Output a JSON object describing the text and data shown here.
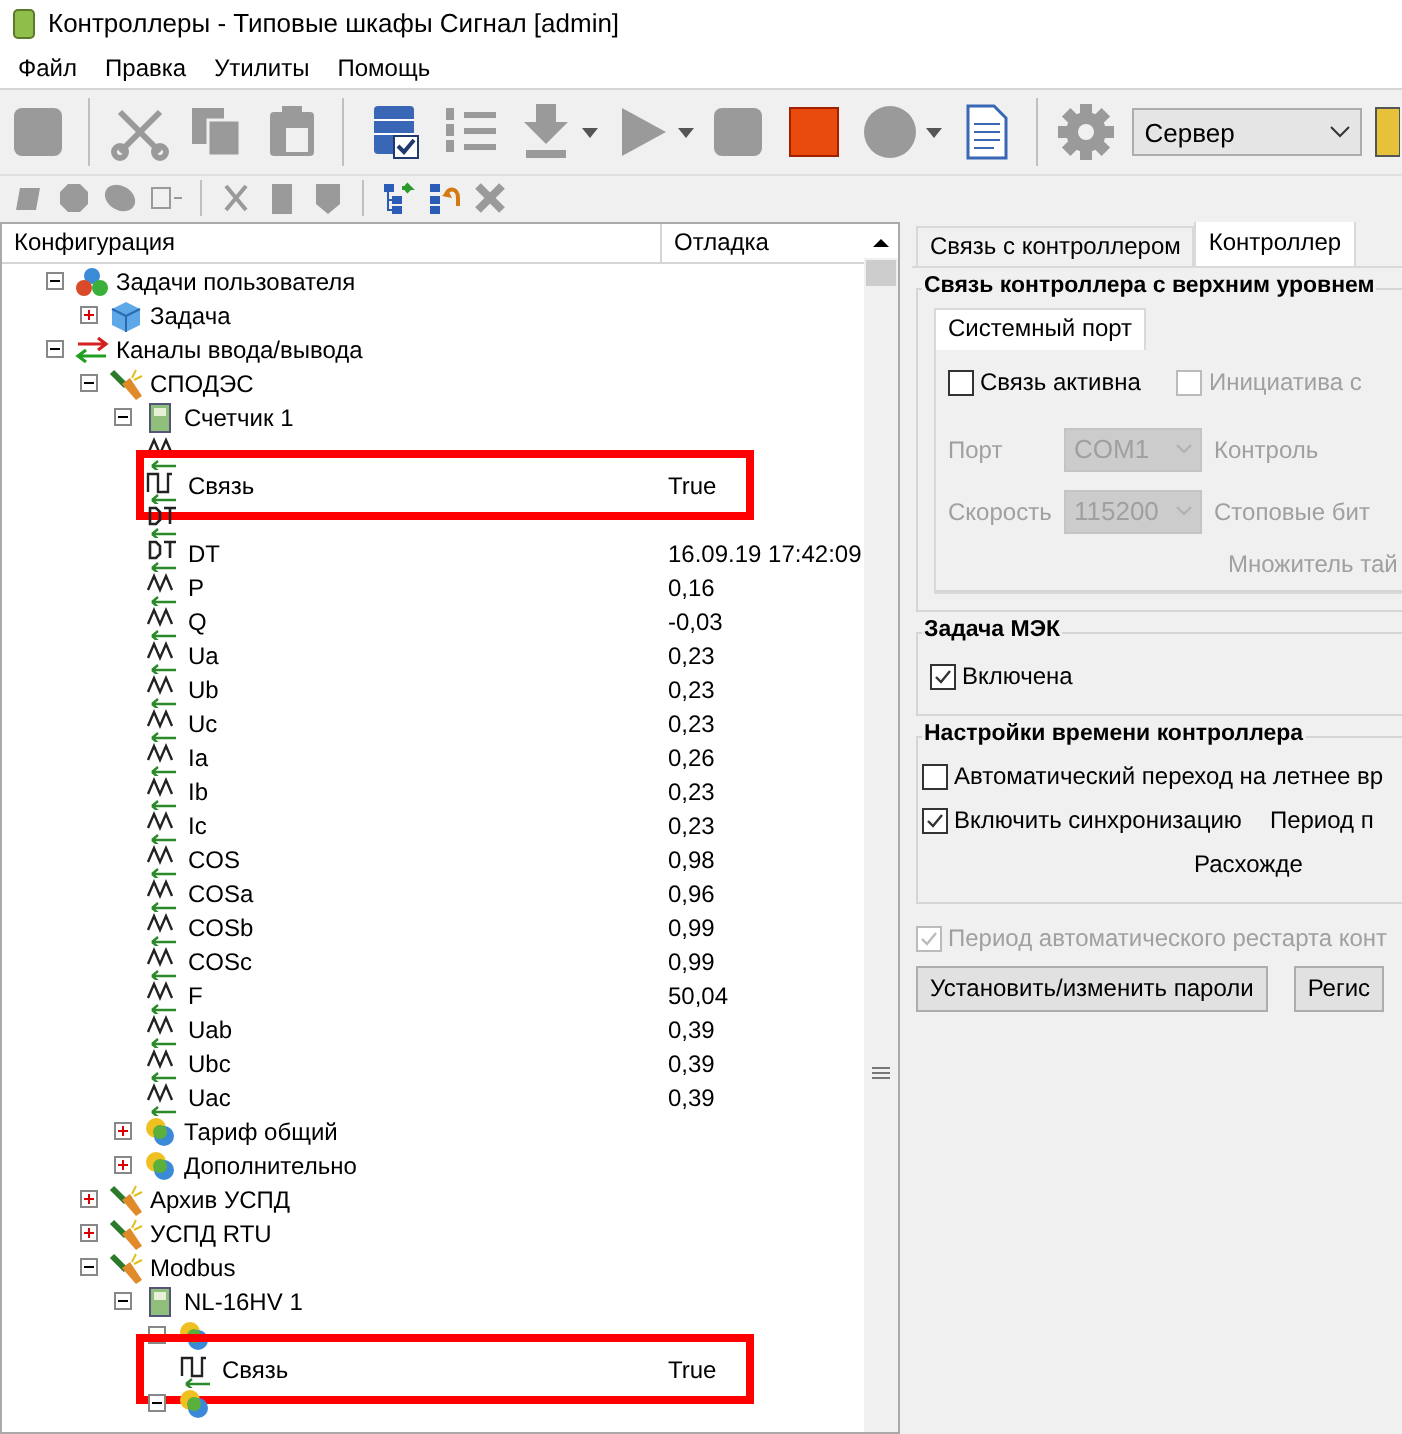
{
  "window": {
    "title": "Контроллеры - Типовые шкафы Сигнал [admin]"
  },
  "menu": [
    "Файл",
    "Правка",
    "Утилиты",
    "Помощь"
  ],
  "toolbar": [
    {
      "kind": "block",
      "disabled": true
    },
    {
      "kind": "separator"
    },
    {
      "kind": "cut",
      "disabled": true
    },
    {
      "kind": "copy",
      "disabled": true
    },
    {
      "kind": "paste",
      "disabled": true
    },
    {
      "kind": "separator"
    },
    {
      "kind": "database",
      "disabled": false
    },
    {
      "kind": "list",
      "disabled": true
    },
    {
      "kind": "download",
      "disabled": true,
      "dropdown": true
    },
    {
      "kind": "play",
      "disabled": true,
      "dropdown": true
    },
    {
      "kind": "block",
      "disabled": true
    },
    {
      "kind": "record",
      "disabled": false
    },
    {
      "kind": "circle",
      "disabled": true,
      "dropdown": true
    },
    {
      "kind": "document",
      "disabled": false
    },
    {
      "kind": "separator"
    },
    {
      "kind": "gear",
      "disabled": true
    },
    {
      "kind": "select",
      "value": "Сервер"
    },
    {
      "kind": "tool",
      "disabled": false
    }
  ],
  "toolbar_2": [
    {
      "kind": "hex",
      "disabled": true
    },
    {
      "kind": "octagon",
      "disabled": true
    },
    {
      "kind": "ellipse",
      "disabled": true
    },
    {
      "kind": "fields",
      "disabled": true
    },
    {
      "kind": "separator"
    },
    {
      "kind": "cut",
      "disabled": true
    },
    {
      "kind": "bin",
      "disabled": true
    },
    {
      "kind": "shield",
      "disabled": true
    },
    {
      "kind": "separator"
    },
    {
      "kind": "tree-add",
      "disabled": false
    },
    {
      "kind": "tree-undo",
      "disabled": false
    },
    {
      "kind": "cross",
      "disabled": true
    }
  ],
  "tree": {
    "columns": [
      "Конфигурация",
      "Отладка"
    ],
    "items": [
      {
        "label": "Задачи пользователя",
        "kind": "tasks",
        "expanded": true,
        "children": [
          {
            "label": "Задача",
            "kind": "cube",
            "expanded": false
          }
        ]
      },
      {
        "label": "Каналы ввода/вывода",
        "kind": "channels",
        "expanded": true,
        "children": [
          {
            "label": "СПОДЭС",
            "kind": "plug",
            "expanded": true,
            "children": [
              {
                "label": "Счетчик 1",
                "kind": "meter",
                "expanded": true,
                "children": [
                  {
                    "kind": "analog"
                  },
                  {
                    "label": "Связь",
                    "kind": "discrete",
                    "value": "True",
                    "highlighted": true
                  },
                  {
                    "kind": "datetime"
                  },
                  {
                    "label": "DT",
                    "kind": "datetime",
                    "value": "16.09.19 17:42:09"
                  },
                  {
                    "label": "P",
                    "kind": "analog",
                    "value": "0,16"
                  },
                  {
                    "label": "Q",
                    "kind": "analog",
                    "value": "-0,03"
                  },
                  {
                    "label": "Ua",
                    "kind": "analog",
                    "value": "0,23"
                  },
                  {
                    "label": "Ub",
                    "kind": "analog",
                    "value": "0,23"
                  },
                  {
                    "label": "Uc",
                    "kind": "analog",
                    "value": "0,23"
                  },
                  {
                    "label": "Ia",
                    "kind": "analog",
                    "value": "0,26"
                  },
                  {
                    "label": "Ib",
                    "kind": "analog",
                    "value": "0,23"
                  },
                  {
                    "label": "Ic",
                    "kind": "analog",
                    "value": "0,23"
                  },
                  {
                    "label": "COS",
                    "kind": "analog",
                    "value": "0,98"
                  },
                  {
                    "label": "COSa",
                    "kind": "analog",
                    "value": "0,96"
                  },
                  {
                    "label": "COSb",
                    "kind": "analog",
                    "value": "0,99"
                  },
                  {
                    "label": "COSc",
                    "kind": "analog",
                    "value": "0,99"
                  },
                  {
                    "label": "F",
                    "kind": "analog",
                    "value": "50,04"
                  },
                  {
                    "label": "Uab",
                    "kind": "analog",
                    "value": "0,39"
                  },
                  {
                    "label": "Ubc",
                    "kind": "analog",
                    "value": "0,39"
                  },
                  {
                    "label": "Uac",
                    "kind": "analog",
                    "value": "0,39"
                  }
                ]
              },
              {
                "label": "Тариф общий",
                "kind": "group",
                "expanded": false
              },
              {
                "label": "Дополнительно",
                "kind": "group",
                "expanded": false
              }
            ]
          },
          {
            "label": "Архив УСПД",
            "kind": "plug",
            "expanded": false
          },
          {
            "label": "УСПД RTU",
            "kind": "plug",
            "expanded": false
          },
          {
            "label": "Modbus",
            "kind": "plug",
            "expanded": true,
            "children": [
              {
                "label": "NL-16HV 1",
                "kind": "meter",
                "expanded": true,
                "children": [
                  {
                    "kind": "group",
                    "expanded": true,
                    "children": [
                      {
                        "label": "Связь",
                        "kind": "discrete",
                        "value": "True",
                        "highlighted": true
                      }
                    ]
                  },
                  {
                    "kind": "group",
                    "expanded": true
                  }
                ]
              }
            ]
          }
        ]
      }
    ]
  },
  "tabs": [
    {
      "label": "Связь с контроллером",
      "selected": false
    },
    {
      "label": "Контроллер",
      "selected": true
    }
  ],
  "groups": [
    {
      "kind": "uplink",
      "title": "Связь контроллера с верхним уровнем",
      "tabs": [
        {
          "label": "Системный порт",
          "selected": true
        }
      ],
      "checks": [
        {
          "label": "Связь активна",
          "checked": false,
          "disabled": false
        },
        {
          "label": "Инициатива с",
          "checked": false,
          "disabled": true
        }
      ],
      "port": {
        "label": "Порт",
        "value": "COM1",
        "side_label": "Контроль"
      },
      "speed": {
        "label": "Скорость",
        "value": "115200",
        "side_label": "Стоповые бит"
      },
      "multiplier_label": "Множитель тай"
    },
    {
      "kind": "checks",
      "title": "Задача МЭК",
      "checks": [
        {
          "label": "Включена",
          "checked": true,
          "disabled": false
        }
      ]
    },
    {
      "kind": "time",
      "title": "Настройки времени контроллера",
      "checks": [
        {
          "label": "Автоматический переход на летнее вр",
          "checked": false,
          "disabled": false
        },
        {
          "label": "Включить синхронизацию",
          "checked": true,
          "disabled": false
        }
      ],
      "sync_period_label": "Период п",
      "divergence_label": "Расхожде"
    }
  ],
  "restart": {
    "label": "Период автоматического рестарта конт",
    "checked": true,
    "disabled": true
  },
  "buttons": [
    "Установить/изменить пароли",
    "Регис"
  ]
}
